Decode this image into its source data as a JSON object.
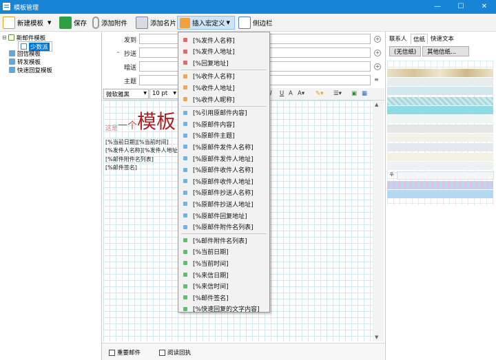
{
  "window": {
    "title": "模板管理",
    "controls": [
      "—",
      "☐",
      "✕"
    ]
  },
  "toolbar": {
    "new_template": "新建模板",
    "save": "保存",
    "add_attachment": "添加附件",
    "add_card": "添加名片",
    "insert_macro": "插入宏定义",
    "sidebar": "侧边栏"
  },
  "tree": {
    "items": [
      {
        "label": "新邮件模板",
        "expander": "⊟"
      },
      {
        "label": "少数派"
      },
      {
        "label": "回信模板"
      },
      {
        "label": "转发模板"
      },
      {
        "label": "快速回复模板"
      }
    ]
  },
  "header": {
    "from_label": "发到",
    "cc_label": "抄送",
    "bcc_label": "暗送",
    "subject_label": "主题",
    "cc_expander": "⌄"
  },
  "format": {
    "font": "微软雅黑",
    "size": "10 pt"
  },
  "editor": {
    "heading_small": "这是",
    "heading_mid": "一个",
    "heading_big": "模板",
    "line1": "[%当前日期][%当前时间]",
    "line2": "[%发件人名称][%发件人地址]",
    "line3": "[%邮件附件名列表]",
    "line4": "[%邮件签名]"
  },
  "bottom": {
    "important": "重要邮件",
    "read_receipt": "阅读回执"
  },
  "right_panel": {
    "tabs": [
      "联系人",
      "信纸",
      "快速文本"
    ],
    "no_paper": "(无信纸)",
    "other_paper": "其他信纸..."
  },
  "macro_menu": {
    "groups": [
      {
        "color": "#e26a6a",
        "items": [
          "[%发件人名称]",
          "[%发件人地址]",
          "[%回复地址]"
        ]
      },
      {
        "color": "#f0a45c",
        "items": [
          "[%收件人名称]",
          "[%收件人地址]",
          "[%收件人昵称]"
        ]
      },
      {
        "color": "#6ab4e8",
        "items": [
          "[%引用原邮件内容]",
          "[%原邮件内容]",
          "[%原邮件主题]",
          "[%原邮件发件人名称]",
          "[%原邮件发件人地址]",
          "[%原邮件收件人名称]",
          "[%原邮件收件人地址]",
          "[%原邮件抄送人名称]",
          "[%原邮件抄送人地址]",
          "[%原邮件回复地址]",
          "[%原邮件附件名列表]"
        ]
      },
      {
        "color": "#5cc06a",
        "items": [
          "[%邮件附件名列表]",
          "[%当前日期]",
          "[%当前时间]",
          "[%来信日期]",
          "[%来信时间]",
          "[%邮件签名]",
          "[%快速回复的文字内容]"
        ]
      }
    ]
  }
}
